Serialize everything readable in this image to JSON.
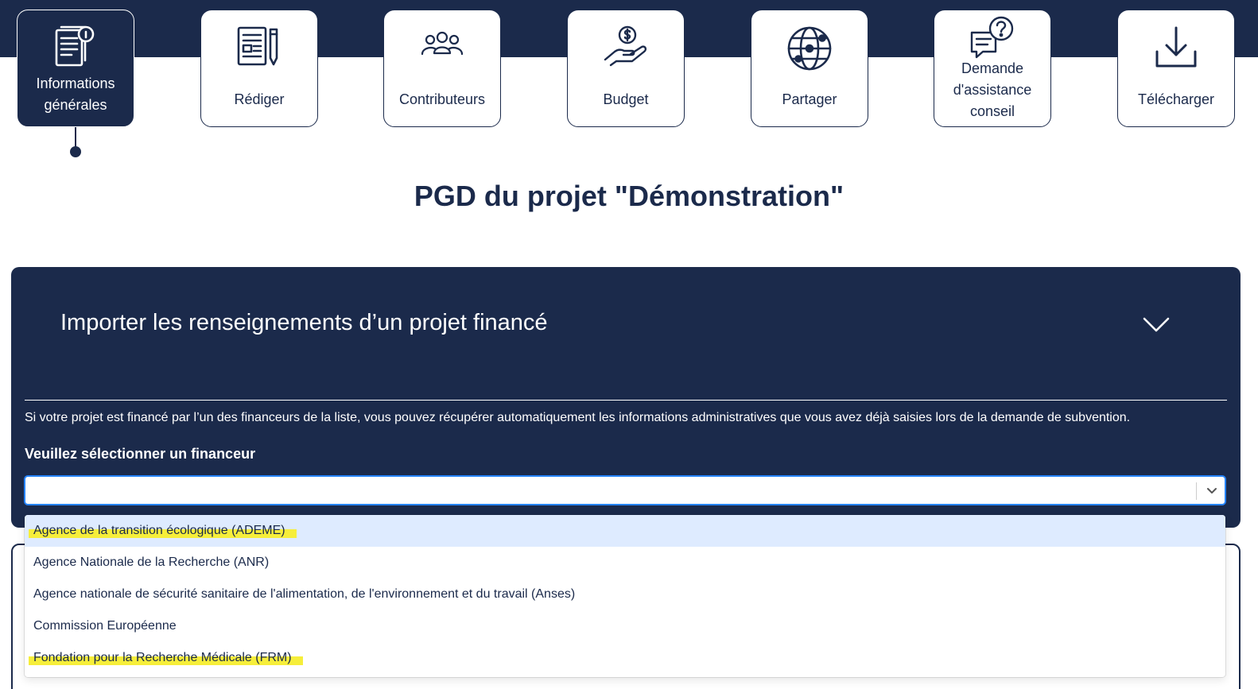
{
  "nav": {
    "items": [
      {
        "label_lines": [
          "Informations",
          "générales"
        ],
        "icon": "document-info-icon",
        "active": true
      },
      {
        "label_lines": [
          "Rédiger"
        ],
        "icon": "document-pencil-icon",
        "active": false
      },
      {
        "label_lines": [
          "Contributeurs"
        ],
        "icon": "people-group-icon",
        "active": false
      },
      {
        "label_lines": [
          "Budget"
        ],
        "icon": "hand-coin-icon",
        "active": false
      },
      {
        "label_lines": [
          "Partager"
        ],
        "icon": "globe-network-icon",
        "active": false
      },
      {
        "label_lines": [
          "Demande",
          "d'assistance",
          "conseil"
        ],
        "icon": "chat-question-icon",
        "active": false
      },
      {
        "label_lines": [
          "Télécharger"
        ],
        "icon": "download-icon",
        "active": false
      }
    ]
  },
  "page": {
    "title": "PGD du projet \"Démonstration\""
  },
  "import_panel": {
    "title": "Importer les renseignements d’un projet financé",
    "toggle_icon": "chevron-down-icon",
    "description": "Si votre projet est financé par l’un des financeurs de la liste, vous pouvez récupérer automatiquement les informations administratives que vous avez déjà saisies lors de la demande de subvention.",
    "select_label": "Veuillez sélectionner un financeur",
    "select_value": "",
    "options": [
      {
        "label": "Agence de la transition écologique (ADEME)",
        "focused": true,
        "highlighted": true
      },
      {
        "label": "Agence Nationale de la Recherche (ANR)",
        "focused": false,
        "highlighted": false
      },
      {
        "label": "Agence nationale de sécurité sanitaire de l'alimentation, de l'environnement et du travail (Anses)",
        "focused": false,
        "highlighted": false
      },
      {
        "label": "Commission Européenne",
        "focused": false,
        "highlighted": false
      },
      {
        "label": "Fondation pour la Recherche Médicale (FRM)",
        "focused": false,
        "highlighted": true
      }
    ]
  },
  "colors": {
    "navy": "#1b2a4b",
    "focus_blue": "#2684ff",
    "option_focus_bg": "#deebff",
    "highlight_yellow": "#f6ee3a"
  }
}
